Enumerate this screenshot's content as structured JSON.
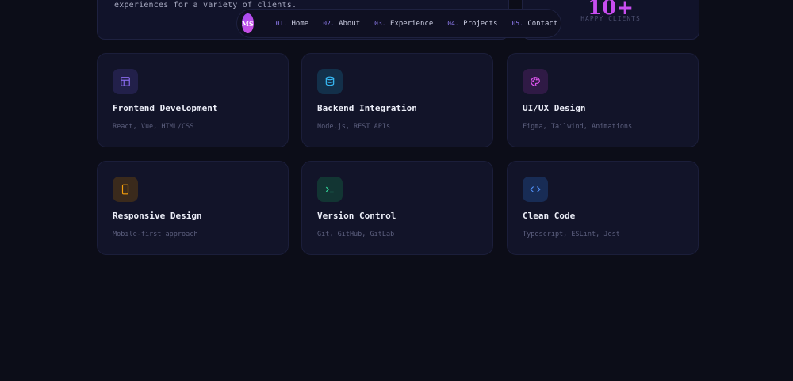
{
  "about": {
    "text": "experiences for a variety of clients."
  },
  "stats": {
    "value": "10+",
    "label": "HAPPY CLIENTS"
  },
  "nav": {
    "logo": "MS",
    "items": [
      {
        "num": "01.",
        "label": "Home"
      },
      {
        "num": "02.",
        "label": "About"
      },
      {
        "num": "03.",
        "label": "Experience"
      },
      {
        "num": "04.",
        "label": "Projects"
      },
      {
        "num": "05.",
        "label": "Contact"
      }
    ]
  },
  "skills": [
    {
      "title": "Frontend Development",
      "sub": "React, Vue, HTML/CSS",
      "icon": "layout-icon",
      "color": "#8b6cf0",
      "bg": "#22204a"
    },
    {
      "title": "Backend Integration",
      "sub": "Node.js, REST APIs",
      "icon": "database-icon",
      "color": "#38bdf8",
      "bg": "#13304a"
    },
    {
      "title": "UI/UX Design",
      "sub": "Figma, Tailwind, Animations",
      "icon": "palette-icon",
      "color": "#e056f0",
      "bg": "#2f1a45"
    },
    {
      "title": "Responsive Design",
      "sub": "Mobile-first approach",
      "icon": "smartphone-icon",
      "color": "#f59e0b",
      "bg": "#3a2a1c"
    },
    {
      "title": "Version Control",
      "sub": "Git, GitHub, GitLab",
      "icon": "terminal-icon",
      "color": "#34d399",
      "bg": "#123533"
    },
    {
      "title": "Clean Code",
      "sub": "Typescript, ESLint, Jest",
      "icon": "code-icon",
      "color": "#4f8ff7",
      "bg": "#182c55"
    }
  ]
}
